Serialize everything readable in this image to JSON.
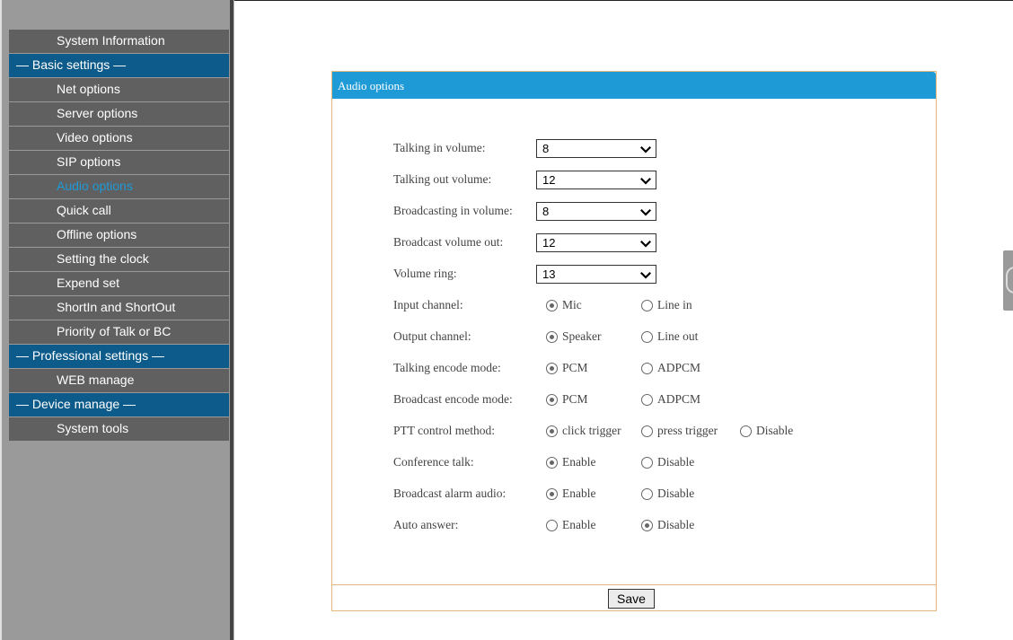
{
  "sidebar": {
    "items": [
      {
        "label": "System Information",
        "type": "item"
      },
      {
        "label": "— Basic settings —",
        "type": "section"
      },
      {
        "label": "Net options",
        "type": "item"
      },
      {
        "label": "Server options",
        "type": "item"
      },
      {
        "label": "Video options",
        "type": "item"
      },
      {
        "label": "SIP options",
        "type": "item"
      },
      {
        "label": "Audio options",
        "type": "item",
        "active": true
      },
      {
        "label": "Quick call",
        "type": "item"
      },
      {
        "label": "Offline options",
        "type": "item"
      },
      {
        "label": "Setting the clock",
        "type": "item"
      },
      {
        "label": "Expend set",
        "type": "item"
      },
      {
        "label": "ShortIn and ShortOut",
        "type": "item"
      },
      {
        "label": "Priority of Talk or BC",
        "type": "item"
      },
      {
        "label": "— Professional settings —",
        "type": "section"
      },
      {
        "label": "WEB manage",
        "type": "item"
      },
      {
        "label": "— Device manage —",
        "type": "section"
      },
      {
        "label": "System tools",
        "type": "item"
      }
    ]
  },
  "panel": {
    "title": "Audio options",
    "selects": [
      {
        "label": "Talking in volume:",
        "value": "8"
      },
      {
        "label": "Talking out volume:",
        "value": "12"
      },
      {
        "label": "Broadcasting in volume:",
        "value": "8"
      },
      {
        "label": "Broadcast volume out:",
        "value": "12"
      },
      {
        "label": "Volume ring:",
        "value": "13"
      }
    ],
    "radios": [
      {
        "label": "Input channel:",
        "options": [
          {
            "text": "Mic",
            "checked": true
          },
          {
            "text": "Line in",
            "checked": false
          }
        ]
      },
      {
        "label": "Output channel:",
        "options": [
          {
            "text": "Speaker",
            "checked": true
          },
          {
            "text": "Line out",
            "checked": false
          }
        ]
      },
      {
        "label": "Talking encode mode:",
        "options": [
          {
            "text": "PCM",
            "checked": true
          },
          {
            "text": "ADPCM",
            "checked": false
          }
        ]
      },
      {
        "label": "Broadcast encode mode:",
        "options": [
          {
            "text": "PCM",
            "checked": true
          },
          {
            "text": "ADPCM",
            "checked": false
          }
        ]
      },
      {
        "label": "PTT control method:",
        "options": [
          {
            "text": "click trigger",
            "checked": true
          },
          {
            "text": "press trigger",
            "checked": false
          },
          {
            "text": "Disable",
            "checked": false
          }
        ]
      },
      {
        "label": "Conference talk:",
        "options": [
          {
            "text": "Enable",
            "checked": true
          },
          {
            "text": "Disable",
            "checked": false
          }
        ]
      },
      {
        "label": "Broadcast alarm audio:",
        "options": [
          {
            "text": "Enable",
            "checked": true
          },
          {
            "text": "Disable",
            "checked": false
          }
        ]
      },
      {
        "label": "Auto answer:",
        "options": [
          {
            "text": "Enable",
            "checked": false
          },
          {
            "text": "Disable",
            "checked": true
          }
        ]
      }
    ],
    "save_label": "Save"
  },
  "icons": {
    "select_arrow": "chevron-down-icon"
  },
  "colors": {
    "accent": "#1e9ad6",
    "section": "#0d5b8a",
    "menu_item": "#606060",
    "panel_border": "#e3b87c"
  }
}
